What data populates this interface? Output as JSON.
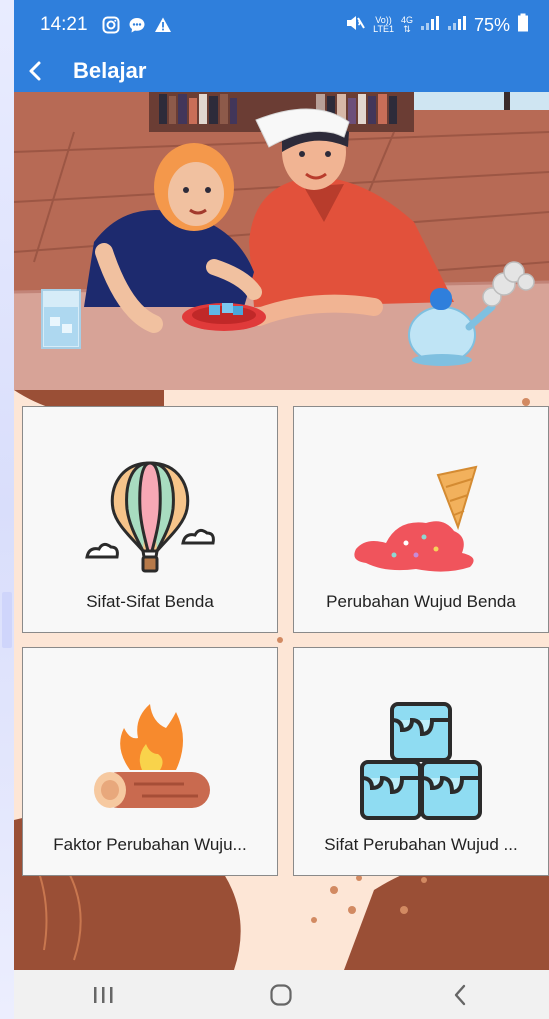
{
  "status_bar": {
    "time": "14:21",
    "left_icons": [
      "instagram-icon",
      "chat-icon",
      "warning-icon"
    ],
    "right_icons": [
      "mute-icon",
      "volte-icon",
      "4g-icon",
      "signal-icon",
      "signal-icon",
      "battery-icon"
    ],
    "volte_top": "Vo))",
    "volte_bottom": "LTE1",
    "network": "4G",
    "battery": "75%"
  },
  "app_bar": {
    "back_icon": "back-arrow-icon",
    "title": "Belajar"
  },
  "menu": [
    {
      "label": "Sifat-Sifat Benda",
      "icon": "hot-air-balloon-icon"
    },
    {
      "label": "Perubahan Wujud Benda",
      "icon": "melted-ice-cream-icon"
    },
    {
      "label": "Faktor Perubahan Wuju...",
      "icon": "campfire-icon"
    },
    {
      "label": "Sifat Perubahan Wujud ...",
      "icon": "ice-cubes-icon"
    }
  ],
  "nav_bar": {
    "recents_icon": "recent-apps-icon",
    "home_icon": "home-icon",
    "back_icon": "nav-back-icon"
  },
  "colors": {
    "primary": "#2f7fdc",
    "background": "#fde6d6",
    "card": "#f8f8f8"
  }
}
